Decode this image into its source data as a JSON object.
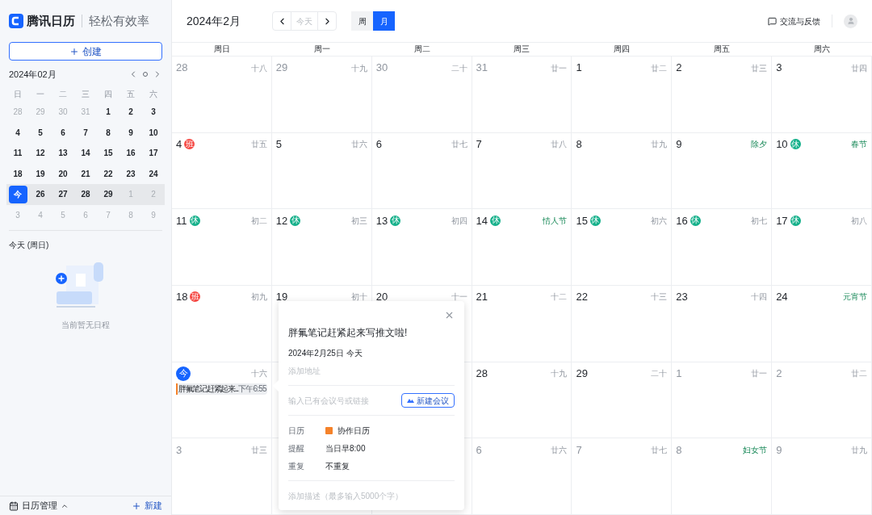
{
  "app": {
    "name": "腾讯日历",
    "slogan": "轻松有效率"
  },
  "create_button": "创建",
  "mini_calendar": {
    "title": "2024年02月",
    "weekdays": [
      "日",
      "一",
      "二",
      "三",
      "四",
      "五",
      "六"
    ],
    "weeks": [
      {
        "current": false,
        "days": [
          {
            "label": "28",
            "muted": true,
            "selected": false
          },
          {
            "label": "29",
            "muted": true,
            "selected": false
          },
          {
            "label": "30",
            "muted": true,
            "selected": false
          },
          {
            "label": "31",
            "muted": true,
            "selected": false
          },
          {
            "label": "1",
            "muted": false,
            "selected": false
          },
          {
            "label": "2",
            "muted": false,
            "selected": false
          },
          {
            "label": "3",
            "muted": false,
            "selected": false
          }
        ]
      },
      {
        "current": false,
        "days": [
          {
            "label": "4",
            "muted": false,
            "selected": false
          },
          {
            "label": "5",
            "muted": false,
            "selected": false
          },
          {
            "label": "6",
            "muted": false,
            "selected": false
          },
          {
            "label": "7",
            "muted": false,
            "selected": false
          },
          {
            "label": "8",
            "muted": false,
            "selected": false
          },
          {
            "label": "9",
            "muted": false,
            "selected": false
          },
          {
            "label": "10",
            "muted": false,
            "selected": false
          }
        ]
      },
      {
        "current": false,
        "days": [
          {
            "label": "11",
            "muted": false,
            "selected": false
          },
          {
            "label": "12",
            "muted": false,
            "selected": false
          },
          {
            "label": "13",
            "muted": false,
            "selected": false
          },
          {
            "label": "14",
            "muted": false,
            "selected": false
          },
          {
            "label": "15",
            "muted": false,
            "selected": false
          },
          {
            "label": "16",
            "muted": false,
            "selected": false
          },
          {
            "label": "17",
            "muted": false,
            "selected": false
          }
        ]
      },
      {
        "current": false,
        "days": [
          {
            "label": "18",
            "muted": false,
            "selected": false
          },
          {
            "label": "19",
            "muted": false,
            "selected": false
          },
          {
            "label": "20",
            "muted": false,
            "selected": false
          },
          {
            "label": "21",
            "muted": false,
            "selected": false
          },
          {
            "label": "22",
            "muted": false,
            "selected": false
          },
          {
            "label": "23",
            "muted": false,
            "selected": false
          },
          {
            "label": "24",
            "muted": false,
            "selected": false
          }
        ]
      },
      {
        "current": true,
        "days": [
          {
            "label": "今",
            "selected": true
          },
          {
            "label": "26",
            "muted": false,
            "selected": false
          },
          {
            "label": "27",
            "muted": false,
            "selected": false
          },
          {
            "label": "28",
            "muted": false,
            "selected": false
          },
          {
            "label": "29",
            "muted": false,
            "selected": false
          },
          {
            "label": "1",
            "muted": true,
            "selected": false
          },
          {
            "label": "2",
            "muted": true,
            "selected": false
          }
        ]
      },
      {
        "current": false,
        "days": [
          {
            "label": "3",
            "muted": true,
            "selected": false
          },
          {
            "label": "4",
            "muted": true,
            "selected": false
          },
          {
            "label": "5",
            "muted": true,
            "selected": false
          },
          {
            "label": "6",
            "muted": true,
            "selected": false
          },
          {
            "label": "7",
            "muted": true,
            "selected": false
          },
          {
            "label": "8",
            "muted": true,
            "selected": false
          },
          {
            "label": "9",
            "muted": true,
            "selected": false
          }
        ]
      }
    ]
  },
  "today_panel": {
    "title": "今天 (周日)",
    "empty_text": "当前暂无日程"
  },
  "footer": {
    "manage": "日历管理",
    "new": "新建"
  },
  "toolbar": {
    "title": "2024年2月",
    "today": "今天",
    "today_disabled": true,
    "views": [
      {
        "label": "周",
        "selected": false
      },
      {
        "label": "月",
        "selected": true
      }
    ],
    "feedback": "交流与反馈"
  },
  "calendar": {
    "weekdays": [
      "周日",
      "周一",
      "周二",
      "周三",
      "周四",
      "周五",
      "周六"
    ],
    "weeks": [
      [
        {
          "kind": "day",
          "day": "28",
          "lunar": "十八",
          "festival": false,
          "muted": true
        },
        {
          "kind": "day",
          "day": "29",
          "lunar": "十九",
          "festival": false,
          "muted": true
        },
        {
          "kind": "day",
          "day": "30",
          "lunar": "二十",
          "festival": false,
          "muted": true
        },
        {
          "kind": "day",
          "day": "31",
          "lunar": "廿一",
          "festival": false,
          "muted": true
        },
        {
          "kind": "day",
          "day": "1",
          "lunar": "廿二",
          "festival": false,
          "muted": false
        },
        {
          "kind": "day",
          "day": "2",
          "lunar": "廿三",
          "festival": false,
          "muted": false
        },
        {
          "kind": "day",
          "day": "3",
          "lunar": "廿四",
          "festival": false,
          "muted": false
        }
      ],
      [
        {
          "kind": "day",
          "day": "4",
          "lunar": "廿五",
          "festival": false,
          "muted": false,
          "badge": {
            "text": "班",
            "color": "#f54a45"
          }
        },
        {
          "kind": "day",
          "day": "5",
          "lunar": "廿六",
          "festival": false,
          "muted": false
        },
        {
          "kind": "day",
          "day": "6",
          "lunar": "廿七",
          "festival": false,
          "muted": false
        },
        {
          "kind": "day",
          "day": "7",
          "lunar": "廿八",
          "festival": false,
          "muted": false
        },
        {
          "kind": "day",
          "day": "8",
          "lunar": "廿九",
          "festival": false,
          "muted": false
        },
        {
          "kind": "day",
          "day": "9",
          "lunar": "除夕",
          "festival": true,
          "muted": false
        },
        {
          "kind": "day",
          "day": "10",
          "lunar": "春节",
          "festival": true,
          "muted": false,
          "badge": {
            "text": "休",
            "color": "#14b08a"
          }
        }
      ],
      [
        {
          "kind": "day",
          "day": "11",
          "lunar": "初二",
          "festival": false,
          "muted": false,
          "badge": {
            "text": "休",
            "color": "#14b08a"
          }
        },
        {
          "kind": "day",
          "day": "12",
          "lunar": "初三",
          "festival": false,
          "muted": false,
          "badge": {
            "text": "休",
            "color": "#14b08a"
          }
        },
        {
          "kind": "day",
          "day": "13",
          "lunar": "初四",
          "festival": false,
          "muted": false,
          "badge": {
            "text": "休",
            "color": "#14b08a"
          }
        },
        {
          "kind": "day",
          "day": "14",
          "lunar": "情人节",
          "festival": true,
          "muted": false,
          "badge": {
            "text": "休",
            "color": "#14b08a"
          }
        },
        {
          "kind": "day",
          "day": "15",
          "lunar": "初六",
          "festival": false,
          "muted": false,
          "badge": {
            "text": "休",
            "color": "#14b08a"
          }
        },
        {
          "kind": "day",
          "day": "16",
          "lunar": "初七",
          "festival": false,
          "muted": false,
          "badge": {
            "text": "休",
            "color": "#14b08a"
          }
        },
        {
          "kind": "day",
          "day": "17",
          "lunar": "初八",
          "festival": false,
          "muted": false,
          "badge": {
            "text": "休",
            "color": "#14b08a"
          }
        }
      ],
      [
        {
          "kind": "day",
          "day": "18",
          "lunar": "初九",
          "festival": false,
          "muted": false,
          "badge": {
            "text": "班",
            "color": "#f54a45"
          }
        },
        {
          "kind": "day",
          "day": "19",
          "lunar": "初十",
          "festival": false,
          "muted": false
        },
        {
          "kind": "day",
          "day": "20",
          "lunar": "十一",
          "festival": false,
          "muted": false
        },
        {
          "kind": "day",
          "day": "21",
          "lunar": "十二",
          "festival": false,
          "muted": false
        },
        {
          "kind": "day",
          "day": "22",
          "lunar": "十三",
          "festival": false,
          "muted": false
        },
        {
          "kind": "day",
          "day": "23",
          "lunar": "十四",
          "festival": false,
          "muted": false
        },
        {
          "kind": "day",
          "day": "24",
          "lunar": "元宵节",
          "festival": true,
          "muted": false
        }
      ],
      [
        {
          "kind": "today",
          "day": "今",
          "lunar": "十六",
          "festival": false,
          "events": [
            {
              "title": "胖氟笔记赶紧起来...",
              "time": "下午6:55",
              "color": "#f5822a"
            }
          ]
        },
        {
          "kind": "covered"
        },
        {
          "kind": "covered"
        },
        {
          "kind": "day",
          "day": "28",
          "lunar": "十九",
          "festival": false,
          "muted": false
        },
        {
          "kind": "day",
          "day": "29",
          "lunar": "二十",
          "festival": false,
          "muted": false
        },
        {
          "kind": "day",
          "day": "1",
          "lunar": "廿一",
          "festival": false,
          "muted": true
        },
        {
          "kind": "day",
          "day": "2",
          "lunar": "廿二",
          "festival": false,
          "muted": true
        }
      ],
      [
        {
          "kind": "day",
          "day": "3",
          "lunar": "廿三",
          "festival": false,
          "muted": true
        },
        {
          "kind": "covered"
        },
        {
          "kind": "covered"
        },
        {
          "kind": "day",
          "day": "6",
          "lunar": "廿六",
          "festival": false,
          "muted": true
        },
        {
          "kind": "day",
          "day": "7",
          "lunar": "廿七",
          "festival": false,
          "muted": true
        },
        {
          "kind": "day",
          "day": "8",
          "lunar": "妇女节",
          "festival": true,
          "muted": true
        },
        {
          "kind": "day",
          "day": "9",
          "lunar": "廿九",
          "festival": false,
          "muted": true
        }
      ]
    ]
  },
  "popup": {
    "title": "胖氟笔记赶紧起来写推文啦!",
    "date": "2024年2月25日 今天",
    "location_placeholder": "添加地址",
    "meeting_placeholder": "输入已有会议号或链接",
    "meeting_button": "新建会议",
    "details": [
      {
        "label": "日历",
        "value": "协作日历",
        "color": "#f5822a"
      },
      {
        "label": "提醒",
        "value": "当日早8:00"
      },
      {
        "label": "重复",
        "value": "不重复"
      }
    ],
    "description_placeholder": "添加描述（最多输入5000个字）"
  }
}
